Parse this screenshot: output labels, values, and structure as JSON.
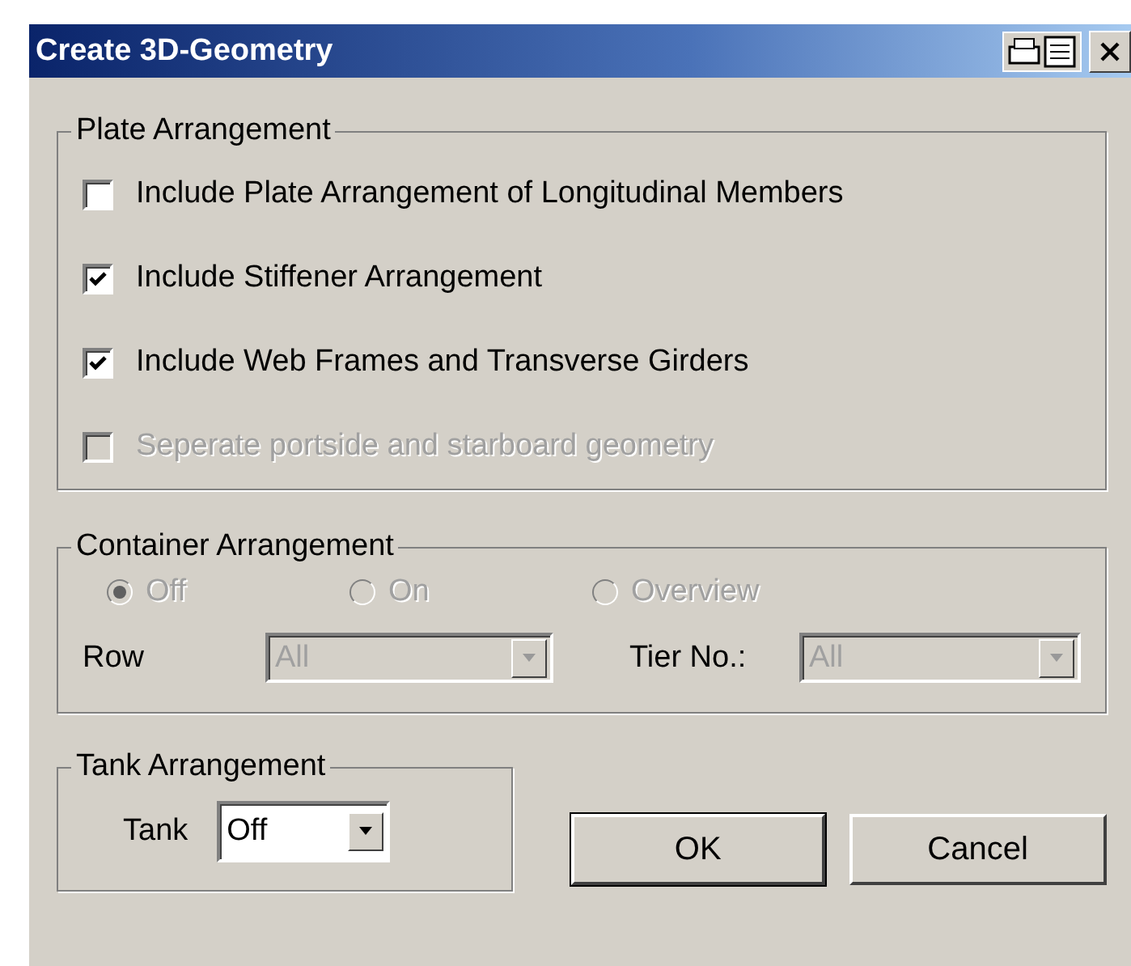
{
  "window": {
    "title": "Create 3D-Geometry"
  },
  "plate_arrangement": {
    "title": "Plate Arrangement",
    "options": [
      {
        "label": "Include Plate Arrangement of Longitudinal Members",
        "checked": false,
        "disabled": false
      },
      {
        "label": "Include Stiffener Arrangement",
        "checked": true,
        "disabled": false
      },
      {
        "label": "Include Web Frames and Transverse Girders",
        "checked": true,
        "disabled": false
      },
      {
        "label": "Seperate portside and starboard geometry",
        "checked": false,
        "disabled": true
      }
    ]
  },
  "container_arrangement": {
    "title": "Container Arrangement",
    "disabled": true,
    "modes": [
      {
        "label": "Off",
        "selected": true
      },
      {
        "label": "On",
        "selected": false
      },
      {
        "label": "Overview",
        "selected": false
      }
    ],
    "row": {
      "label": "Row",
      "value": "All"
    },
    "tier": {
      "label": "Tier No.:",
      "value": "All"
    }
  },
  "tank_arrangement": {
    "title": "Tank Arrangement",
    "tank": {
      "label": "Tank",
      "value": "Off"
    }
  },
  "buttons": [
    {
      "label": "OK",
      "kind": "default"
    },
    {
      "label": "Cancel",
      "kind": "normal"
    }
  ]
}
